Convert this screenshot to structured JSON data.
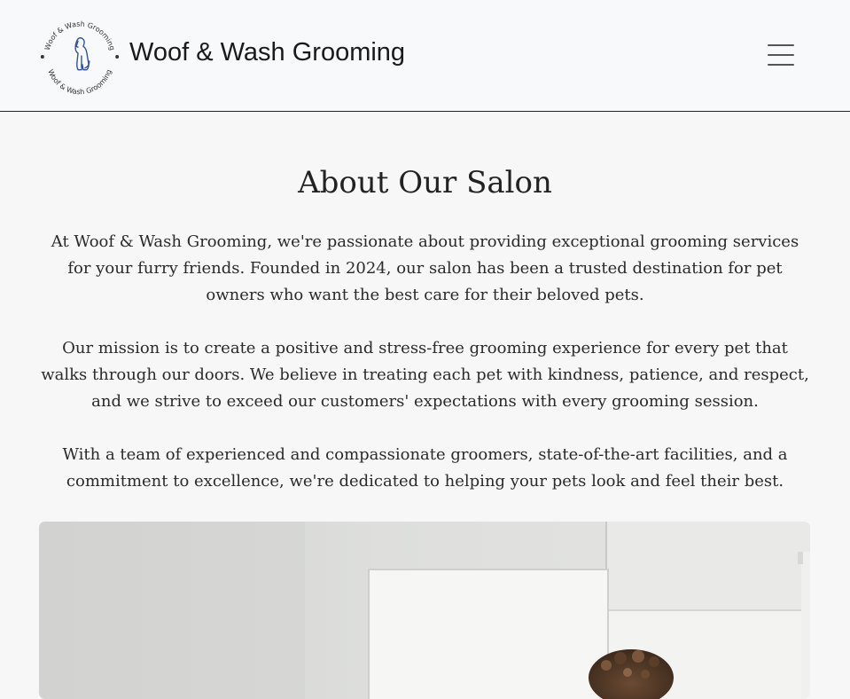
{
  "header": {
    "logo_ring_text": "Woof & Wash Grooming",
    "brand": "Woof & Wash Grooming",
    "menu_icon": "hamburger-menu-icon"
  },
  "main": {
    "title": "About Our Salon",
    "paragraphs": [
      "At Woof & Wash Grooming, we're passionate about providing exceptional grooming services for your furry friends. Founded in 2024, our salon has been a trusted destination for pet owners who want the best care for their beloved pets.",
      "Our mission is to create a positive and stress-free grooming experience for every pet that walks through our doors. We believe in treating each pet with kindness, patience, and respect, and we strive to exceed our customers' expectations with every grooming session.",
      "With a team of experienced and compassionate groomers, state-of-the-art facilities, and a commitment to excellence, we're dedicated to helping your pets look and feel their best."
    ]
  },
  "colors": {
    "page_background": "#f7f7f7",
    "navbar_background": "#f8f9fa",
    "logo_dog": "#2f4f9a"
  }
}
